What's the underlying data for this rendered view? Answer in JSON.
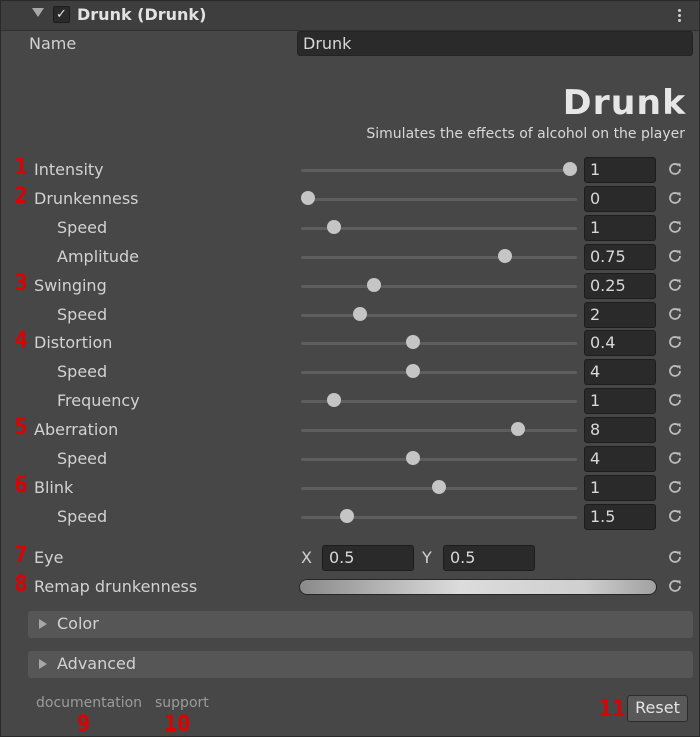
{
  "component": {
    "title": "Drunk (Drunk)",
    "enabled_check": "✓"
  },
  "name_field": {
    "label": "Name",
    "value": "Drunk"
  },
  "banner": {
    "logo": "Drunk",
    "subtitle": "Simulates the effects of alcohol on the player"
  },
  "rows": [
    {
      "num": "1",
      "label": "Intensity",
      "value": "1",
      "slider": 1.0
    },
    {
      "num": "2",
      "label": "Drunkenness",
      "value": "0",
      "slider": 0.0
    },
    {
      "num": "",
      "label": "Speed",
      "value": "1",
      "slider": 0.1
    },
    {
      "num": "",
      "label": "Amplitude",
      "value": "0.75",
      "slider": 0.75
    },
    {
      "num": "3",
      "label": "Swinging",
      "value": "0.25",
      "slider": 0.25
    },
    {
      "num": "",
      "label": "Speed",
      "value": "2",
      "slider": 0.2
    },
    {
      "num": "4",
      "label": "Distortion",
      "value": "0.4",
      "slider": 0.4
    },
    {
      "num": "",
      "label": "Speed",
      "value": "4",
      "slider": 0.4
    },
    {
      "num": "",
      "label": "Frequency",
      "value": "1",
      "slider": 0.1
    },
    {
      "num": "5",
      "label": "Aberration",
      "value": "8",
      "slider": 0.8
    },
    {
      "num": "",
      "label": "Speed",
      "value": "4",
      "slider": 0.4
    },
    {
      "num": "6",
      "label": "Blink",
      "value": "1",
      "slider": 0.5
    },
    {
      "num": "",
      "label": "Speed",
      "value": "1.5",
      "slider": 0.15
    }
  ],
  "eye": {
    "num": "7",
    "label": "Eye",
    "x_label": "X",
    "x_value": "0.5",
    "y_label": "Y",
    "y_value": "0.5"
  },
  "remap": {
    "num": "8",
    "label": "Remap drunkenness"
  },
  "foldouts": {
    "color": "Color",
    "advanced": "Advanced"
  },
  "footer": {
    "documentation": "documentation",
    "documentation_num": "9",
    "support": "support",
    "support_num": "10",
    "reset": "Reset",
    "reset_num": "11"
  },
  "icons": {
    "reset": "reset-icon",
    "menu": "kebab-menu-icon",
    "fold": "chevron-down-icon"
  },
  "colors": {
    "annotation": "#e00000",
    "panel": "#474747",
    "field": "#2a2a2a"
  }
}
